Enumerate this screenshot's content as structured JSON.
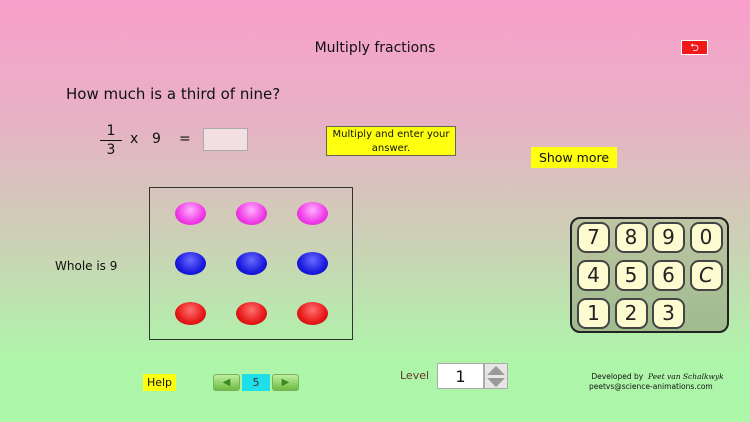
{
  "title": "Multiply fractions",
  "back_icon": "back-arrow-icon",
  "question": "How much is a third of nine?",
  "equation": {
    "numerator": "1",
    "denominator": "3",
    "times": "x",
    "factor": "9",
    "equals": "=",
    "answer": ""
  },
  "hint": "Multiply and enter your answer.",
  "show_more": "Show more",
  "whole_label": "Whole is 9",
  "dots": {
    "rows": [
      {
        "color": "pink",
        "count": 3
      },
      {
        "color": "blue",
        "count": 3
      },
      {
        "color": "red",
        "count": 3
      }
    ]
  },
  "keypad": [
    "7",
    "8",
    "9",
    "0",
    "4",
    "5",
    "6",
    "C",
    "1",
    "2",
    "3"
  ],
  "help": "Help",
  "pager": {
    "prev": "◀",
    "page": "5",
    "next": "▶"
  },
  "level": {
    "label": "Level",
    "value": "1"
  },
  "credit": {
    "prefix": "Developed by",
    "author": "Peet van Schalkwyk",
    "email": "peetvs@science-animations.com"
  }
}
